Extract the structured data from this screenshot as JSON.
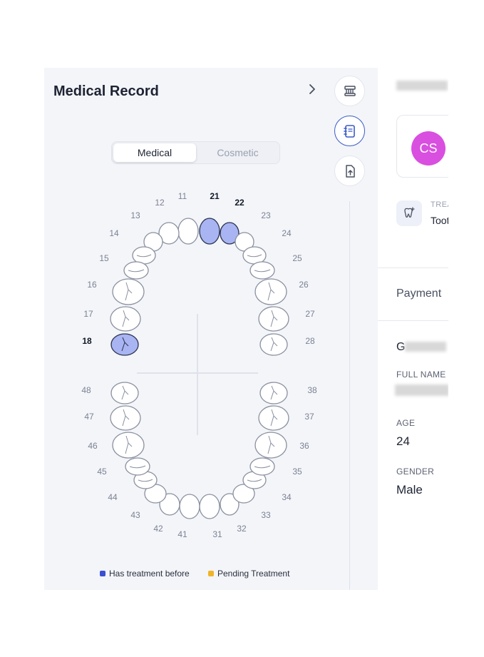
{
  "panel": {
    "title": "Medical Record",
    "tabs": [
      "Medical",
      "Cosmetic"
    ],
    "active_tab": "Medical"
  },
  "side_buttons": [
    {
      "icon": "toothbrush-icon"
    },
    {
      "icon": "notebook-icon",
      "selected": true
    },
    {
      "icon": "file-upload-icon"
    }
  ],
  "tooth_chart": {
    "upper_labels": {
      "left": [
        "11",
        "12",
        "13",
        "14",
        "15",
        "16",
        "17",
        "18"
      ],
      "right": [
        "21",
        "22",
        "23",
        "24",
        "25",
        "26",
        "27",
        "28"
      ]
    },
    "lower_labels": {
      "left": [
        "41",
        "42",
        "43",
        "44",
        "45",
        "46",
        "47",
        "48"
      ],
      "right": [
        "31",
        "32",
        "33",
        "34",
        "35",
        "36",
        "37",
        "38"
      ]
    },
    "treated_teeth": [
      "21",
      "22",
      "18"
    ],
    "pending_teeth": []
  },
  "legend": {
    "treated": {
      "label": "Has treatment before",
      "color": "#3b4fd1"
    },
    "pending": {
      "label": "Pending Treatment",
      "color": "#f0b429"
    }
  },
  "right": {
    "avatar_initials": "CS",
    "treatment_label": "TREA",
    "treatment_value": "Toot",
    "payment_label": "Payment",
    "g_text": "G",
    "full_name_label": "FULL NAME",
    "age_label": "AGE",
    "age_value": "24",
    "gender_label": "GENDER",
    "gender_value": "Male"
  },
  "colors": {
    "treated_fill": "#a9b4f2",
    "avatar": "#d94fe0",
    "accent": "#3a5bc7"
  }
}
